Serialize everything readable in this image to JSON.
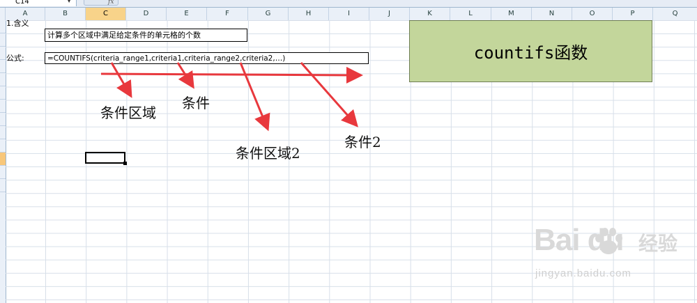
{
  "formula_bar": {
    "name_box": "C14",
    "fx_label": "fx"
  },
  "columns": [
    "A",
    "B",
    "C",
    "D",
    "E",
    "F",
    "G",
    "H",
    "I",
    "J",
    "K",
    "L",
    "M",
    "N",
    "O",
    "P",
    "Q"
  ],
  "active_column": "C",
  "cells": {
    "a2": "1.含义",
    "b2": "计算多个区域中满足给定条件的单元格的个数",
    "a4": "公式:",
    "b4": "=COUNTIFS(criteria_range1,criteria1,criteria_range2,criteria2,…)"
  },
  "title_box": "countifs函数",
  "annotations": {
    "range1": "条件区域",
    "crit1": "条件",
    "range2": "条件区域2",
    "crit2": "条件2"
  },
  "watermark": {
    "logo": "Bai  du",
    "cn": "经验",
    "url": "jingyan.baidu.com"
  },
  "colors": {
    "title_fill": "#c3d69b",
    "arrow": "#e8383d",
    "active_header": "#f8d38a"
  }
}
